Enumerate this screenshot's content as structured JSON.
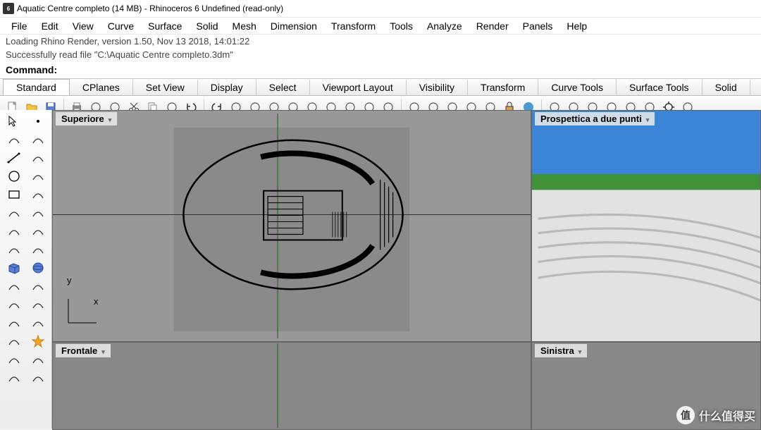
{
  "title": "Aquatic Centre completo (14 MB) - Rhinoceros 6 Undefined (read-only)",
  "app_icon_text": "6",
  "menu": [
    "File",
    "Edit",
    "View",
    "Curve",
    "Surface",
    "Solid",
    "Mesh",
    "Dimension",
    "Transform",
    "Tools",
    "Analyze",
    "Render",
    "Panels",
    "Help"
  ],
  "cmd_history": [
    "Loading Rhino Render, version 1.50, Nov 13 2018, 14:01:22",
    "Successfully read file \"C:\\Aquatic Centre completo.3dm\""
  ],
  "cmd_label": "Command:",
  "cmd_value": "",
  "tabs": [
    "Standard",
    "CPlanes",
    "Set View",
    "Display",
    "Select",
    "Viewport Layout",
    "Visibility",
    "Transform",
    "Curve Tools",
    "Surface Tools",
    "Solid"
  ],
  "active_tab": 0,
  "toolbar_icons": [
    "new-file",
    "open-file",
    "save-file",
    "print",
    "paste",
    "clipboard",
    "cut",
    "copy",
    "paste-special",
    "undo",
    "redo",
    "pan",
    "rotate-view",
    "center",
    "zoom-extents",
    "zoom-window",
    "zoom-selected",
    "zoom-target",
    "zoom-1-1",
    "set-cplane",
    "ruler",
    "show-hide",
    "show-toolbar",
    "layers",
    "hide-objects",
    "lock",
    "render",
    "render-preview",
    "material-1",
    "material-2",
    "material-3",
    "material-4",
    "filter",
    "options",
    "help"
  ],
  "sidebar_tools": [
    [
      "arrow",
      "point"
    ],
    [
      "lasso",
      "freeform-lasso"
    ],
    [
      "line",
      "polyline"
    ],
    [
      "circle",
      "arc"
    ],
    [
      "rectangle",
      "polygon"
    ],
    [
      "polygon-hex",
      "remove-hex"
    ],
    [
      "curve",
      "curve-edit"
    ],
    [
      "deform",
      "blend"
    ],
    [
      "box",
      "sphere"
    ],
    [
      "cylinder",
      "torus"
    ],
    [
      "cone",
      "pipe"
    ],
    [
      "explode",
      "join"
    ],
    [
      "revolve",
      "star"
    ],
    [
      "trim",
      "split"
    ],
    [
      "boolean-1",
      "boolean-2"
    ]
  ],
  "viewports": {
    "top_left": "Superiore",
    "top_right": "Prospettica a due punti",
    "bottom_left": "Frontale",
    "bottom_right": "Sinistra"
  },
  "axes": {
    "y": "y",
    "x": "x"
  },
  "watermark": {
    "badge": "值",
    "text": "什么值得买"
  }
}
